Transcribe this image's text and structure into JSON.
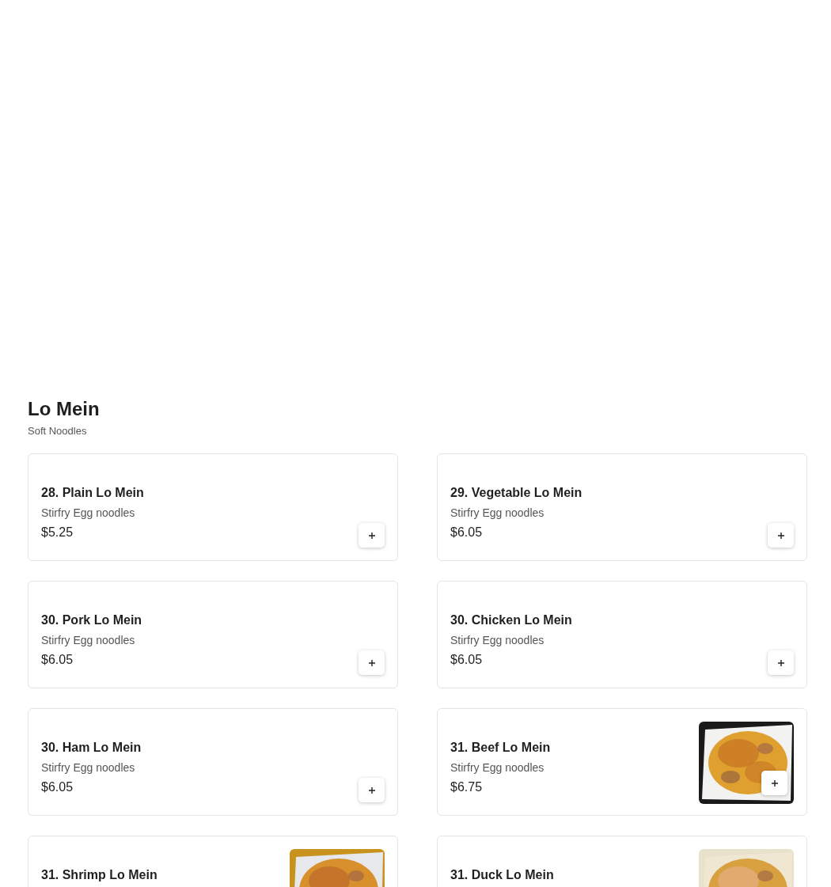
{
  "section": {
    "title": "Lo Mein",
    "subtitle": "Soft Noodles"
  },
  "items": [
    {
      "kind": "plain",
      "name": "28. Plain Lo Mein",
      "description": "Stirfry Egg noodles",
      "price": "$5.25",
      "add_button": true
    },
    {
      "kind": "plain",
      "name": "29. Vegetable Lo Mein",
      "description": "Stirfry Egg noodles",
      "price": "$6.05",
      "add_button": true
    },
    {
      "kind": "plain",
      "name": "30. Pork Lo Mein",
      "description": "Stirfry Egg noodles",
      "price": "$6.05",
      "add_button": true
    },
    {
      "kind": "plain",
      "name": "30. Chicken Lo Mein",
      "description": "Stirfry Egg noodles",
      "price": "$6.05",
      "add_button": true
    },
    {
      "kind": "plain",
      "name": "30. Ham Lo Mein",
      "description": "Stirfry Egg noodles",
      "price": "$6.05",
      "add_button": true
    },
    {
      "kind": "picture",
      "name": "31. Beef Lo Mein",
      "description": "Stirfry Egg noodles",
      "price": "$6.75",
      "add_button": true
    },
    {
      "kind": "picture",
      "name": "31. Shrimp Lo Mein",
      "add_button": false
    },
    {
      "kind": "picture",
      "name": "31. Duck Lo Mein",
      "add_button": false
    }
  ]
}
